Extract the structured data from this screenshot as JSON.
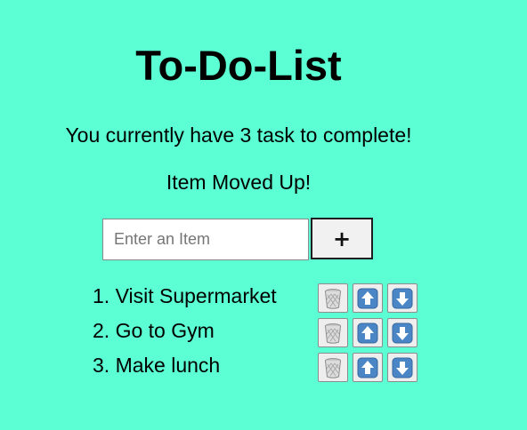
{
  "header": {
    "title": "To-Do-List"
  },
  "summary": {
    "task_count_text": "You currently have 3 task to complete!",
    "status_message": "Item Moved Up!"
  },
  "form": {
    "input_placeholder": "Enter an Item",
    "input_value": "",
    "add_button_label": "+"
  },
  "tasks": [
    {
      "text": "1. Visit Supermarket"
    },
    {
      "text": "2. Go to Gym"
    },
    {
      "text": "3. Make lunch"
    }
  ],
  "icons": {
    "delete": "wastebasket-icon",
    "move_up": "up-arrow-icon",
    "move_down": "down-arrow-icon"
  },
  "colors": {
    "background": "#5bffd3",
    "arrow_button": "#4a86c5"
  }
}
